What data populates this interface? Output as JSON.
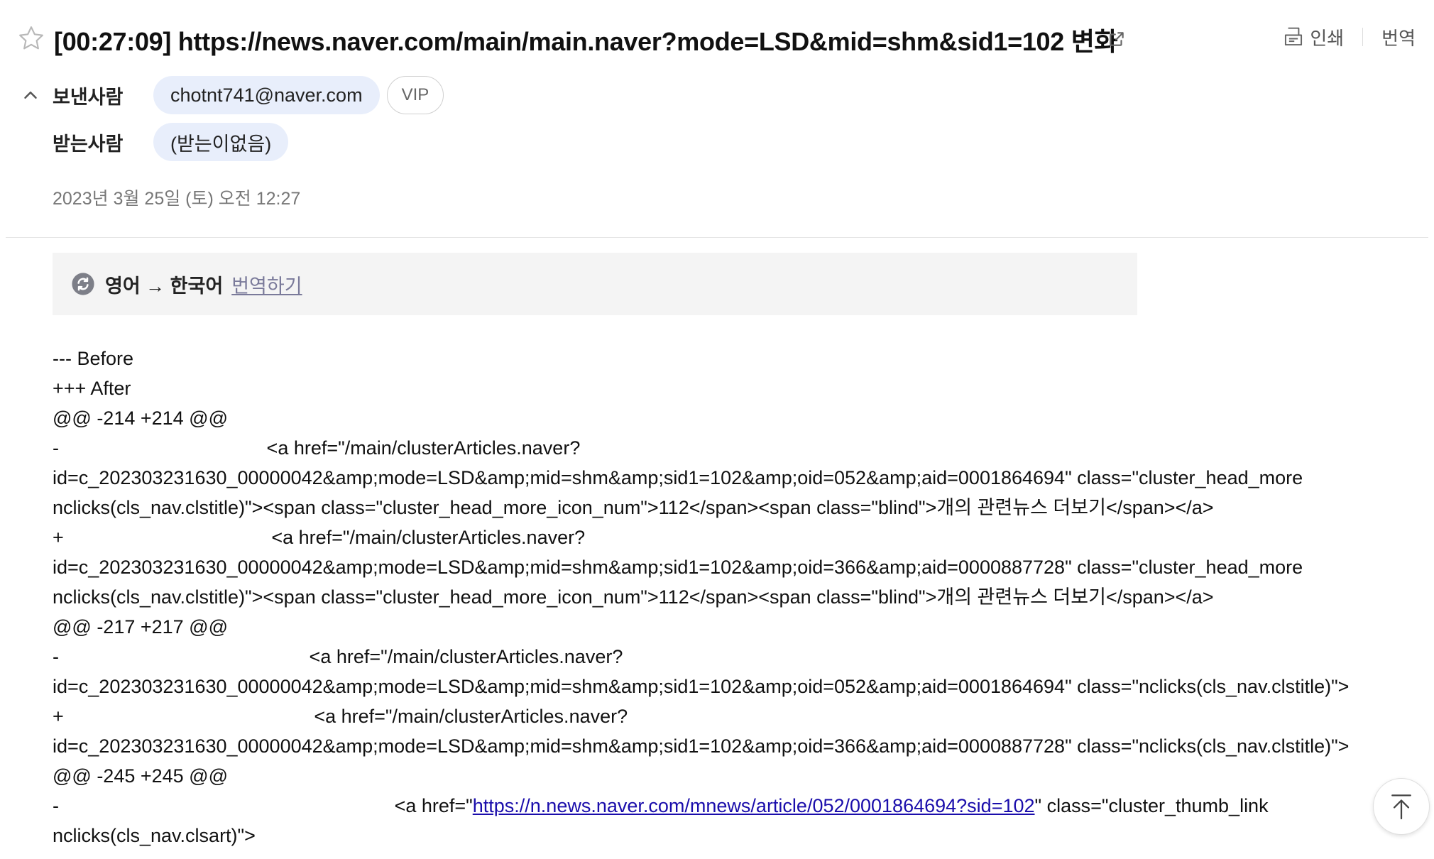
{
  "header": {
    "subject": "[00:27:09] https://news.naver.com/main/main.naver?mode=LSD&mid=shm&sid1=102 변화",
    "print_label": "인쇄",
    "translate_label": "번역"
  },
  "sender": {
    "label": "보낸사람",
    "email": "chotnt741@naver.com",
    "badge": "VIP"
  },
  "receiver": {
    "label": "받는사람",
    "value": "(받는이없음)"
  },
  "date": "2023년 3월 25일 (토) 오전 12:27",
  "translate_banner": {
    "languages": "영어 → 한국어",
    "action": "번역하기"
  },
  "body": {
    "lines": [
      "--- Before",
      "+++ After",
      "@@ -214 +214 @@",
      "-                                       <a href=\"/main/clusterArticles.naver?",
      "id=c_202303231630_00000042&amp;mode=LSD&amp;mid=shm&amp;sid1=102&amp;oid=052&amp;aid=0001864694\" class=\"cluster_head_more",
      "nclicks(cls_nav.clstitle)\"><span class=\"cluster_head_more_icon_num\">112</span><span class=\"blind\">개의 관련뉴스 더보기</span></a>",
      "+                                       <a href=\"/main/clusterArticles.naver?",
      "id=c_202303231630_00000042&amp;mode=LSD&amp;mid=shm&amp;sid1=102&amp;oid=366&amp;aid=0000887728\" class=\"cluster_head_more",
      "nclicks(cls_nav.clstitle)\"><span class=\"cluster_head_more_icon_num\">112</span><span class=\"blind\">개의 관련뉴스 더보기</span></a>",
      "@@ -217 +217 @@",
      "-                                               <a href=\"/main/clusterArticles.naver?",
      "id=c_202303231630_00000042&amp;mode=LSD&amp;mid=shm&amp;sid1=102&amp;oid=052&amp;aid=0001864694\" class=\"nclicks(cls_nav.clstitle)\">",
      "+                                               <a href=\"/main/clusterArticles.naver?",
      "id=c_202303231630_00000042&amp;mode=LSD&amp;mid=shm&amp;sid1=102&amp;oid=366&amp;aid=0000887728\" class=\"nclicks(cls_nav.clstitle)\">",
      "@@ -245 +245 @@"
    ],
    "link_line": {
      "prefix": "-                                                               <a href=\"",
      "link": "https://n.news.naver.com/mnews/article/052/0001864694?sid=102",
      "suffix": "\" class=\"cluster_thumb_link"
    },
    "after_link": "nclicks(cls_nav.clsart)\">"
  },
  "icons": {
    "star": "star-icon",
    "external": "external-link-icon",
    "print": "print-icon",
    "collapse": "chevron-up-icon",
    "refresh": "refresh-icon",
    "scroll_top": "arrow-up-icon"
  },
  "colors": {
    "chip_bg": "#e8eefb",
    "link": "#1a0dab",
    "banner_bg": "#f4f4f4"
  }
}
